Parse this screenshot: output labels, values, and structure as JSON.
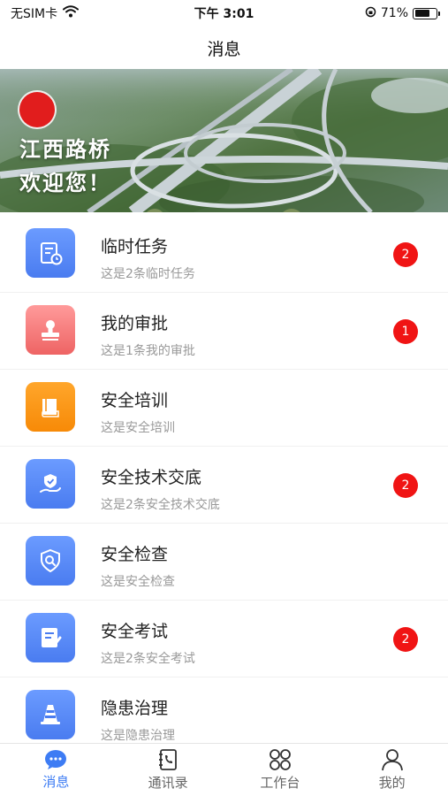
{
  "status_bar": {
    "carrier": "无SIM卡",
    "time": "下午 3:01",
    "battery_percent": "71%",
    "battery_level": 0.71
  },
  "nav": {
    "title": "消息"
  },
  "banner": {
    "line1": "江西路桥",
    "line2": "欢迎您！"
  },
  "messages": [
    {
      "title": "临时任务",
      "subtitle": "这是2条临时任务",
      "badge": "2",
      "icon": "clipboard-clock-icon",
      "color": "#4a7cf0"
    },
    {
      "title": "我的审批",
      "subtitle": "这是1条我的审批",
      "badge": "1",
      "icon": "stamp-icon",
      "color": "#ee6464"
    },
    {
      "title": "安全培训",
      "subtitle": "这是安全培训",
      "badge": "",
      "icon": "book-icon",
      "color": "#f78a07"
    },
    {
      "title": "安全技术交底",
      "subtitle": "这是2条安全技术交底",
      "badge": "2",
      "icon": "shield-hand-icon",
      "color": "#4a7cf0"
    },
    {
      "title": "安全检查",
      "subtitle": "这是安全检查",
      "badge": "",
      "icon": "shield-search-icon",
      "color": "#4a7cf0"
    },
    {
      "title": "安全考试",
      "subtitle": "这是2条安全考试",
      "badge": "2",
      "icon": "exam-paper-icon",
      "color": "#4a7cf0"
    },
    {
      "title": "隐患治理",
      "subtitle": "这是隐患治理",
      "badge": "",
      "icon": "traffic-cone-icon",
      "color": "#4a7cf0"
    }
  ],
  "tabs": [
    {
      "label": "消息",
      "icon": "chat-bubble-icon",
      "active": true
    },
    {
      "label": "通讯录",
      "icon": "contacts-book-icon",
      "active": false
    },
    {
      "label": "工作台",
      "icon": "grid-circles-icon",
      "active": false
    },
    {
      "label": "我的",
      "icon": "user-icon",
      "active": false
    }
  ],
  "colors": {
    "accent": "#3d7cf4",
    "badge": "#f01414"
  }
}
